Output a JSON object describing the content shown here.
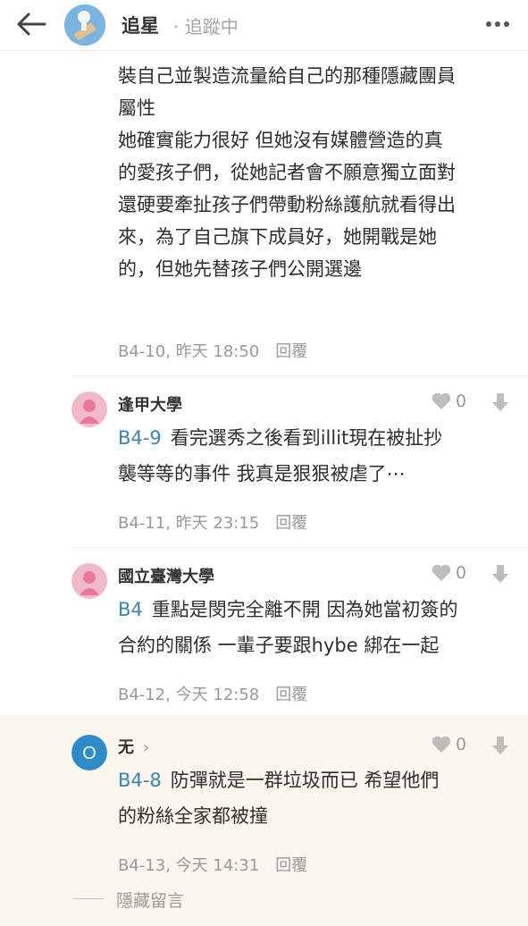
{
  "header": {
    "title": "追星",
    "follow_status": "· 追蹤中"
  },
  "post_body": {
    "lines": [
      "裝自己並製造流量給自己的那種隱藏團員",
      "屬性",
      "她確實能力很好 但她沒有媒體營造的真",
      "的愛孩子們，從她記者會不願意獨立面對",
      "還硬要牽扯孩子們帶動粉絲護航就看得出",
      "來，為了自己旗下成員好，她開戰是她",
      "的，但她先替孩子們公開選邊"
    ],
    "floor_time": "B4-10, 昨天 18:50",
    "reply_label": "回覆"
  },
  "comments": [
    {
      "name": "逢甲大學",
      "likes": "0",
      "ref": "B4-9",
      "line1": "看完選秀之後看到illit現在被扯抄",
      "line2": "襲等等的事件 我真是狠狠被虐了⋯",
      "floor_time": "B4-11, 昨天 23:15",
      "reply_label": "回覆"
    },
    {
      "name": "國立臺灣大學",
      "likes": "0",
      "ref": "B4",
      "line1": "重點是閔完全離不開 因為她當初簽的",
      "line2": "合約的關係 一輩子要跟hybe 綁在一起",
      "floor_time": "B4-12, 今天 12:58",
      "reply_label": "回覆"
    },
    {
      "name": "无",
      "chevron": "›",
      "avatar_letter": "O",
      "likes": "0",
      "ref": "B4-8",
      "line1": "防彈就是一群垃圾而已 希望他們",
      "line2": "的粉絲全家都被撞",
      "floor_time": "B4-13, 今天 14:31",
      "reply_label": "回覆"
    }
  ],
  "hidden_comments_label": "隱藏留言",
  "colors": {
    "link": "#3a84b5",
    "muted": "#9a9a9a",
    "highlight_bg": "#fcf6ee",
    "avatar_pink": "#f2b9cb",
    "avatar_blue": "#2d8bc9"
  },
  "icons": [
    "back-arrow-icon",
    "more-dots-icon",
    "heart-icon",
    "downvote-arrow-icon"
  ]
}
